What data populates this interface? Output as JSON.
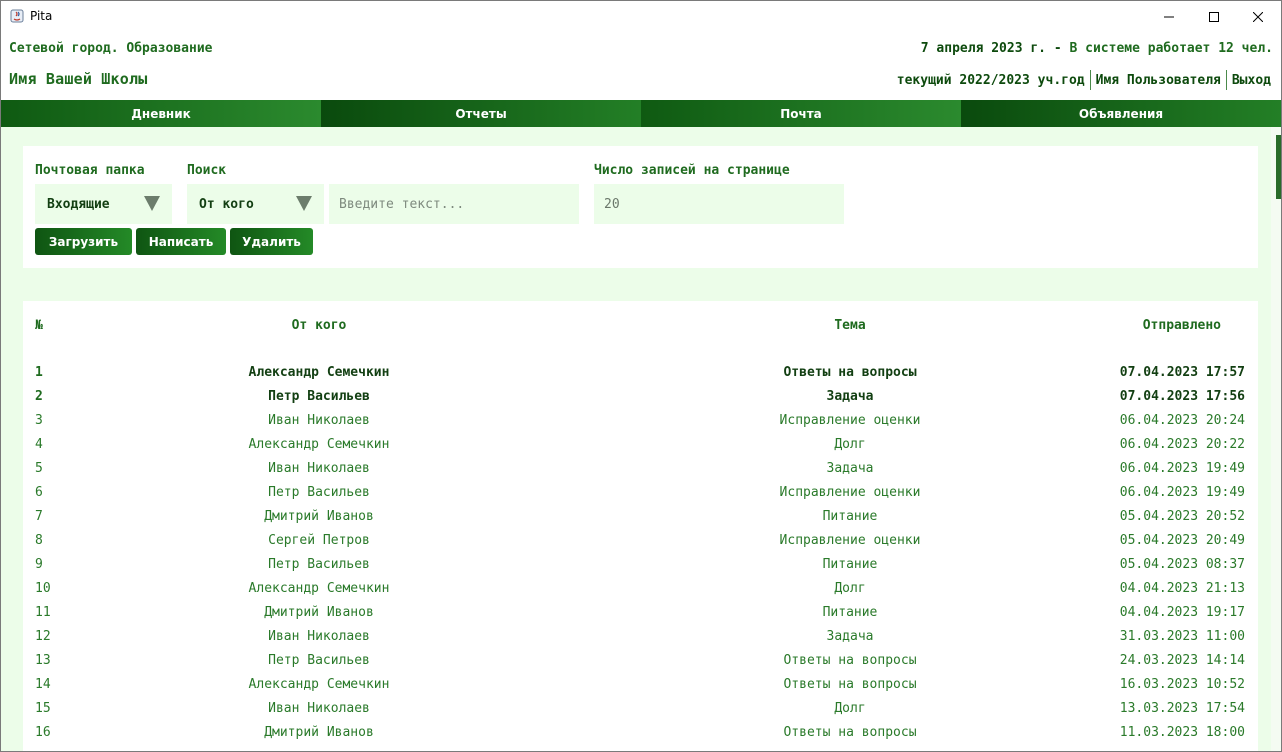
{
  "window": {
    "title": "Pita"
  },
  "header": {
    "org_name": "Сетевой город. Образование",
    "school_name": "Имя Вашей Школы",
    "status_date": "7 апреля 2023 г. -",
    "status_text": "В системе работает 12 чел.",
    "school_year": "текущий 2022/2023 уч.год",
    "user_name": "Имя Пользователя",
    "logout": "Выход"
  },
  "nav": {
    "tabs": [
      {
        "label": "Дневник"
      },
      {
        "label": "Отчеты"
      },
      {
        "label": "Почта"
      },
      {
        "label": "Объявления"
      }
    ]
  },
  "filters": {
    "folder_label": "Почтовая папка",
    "folder_value": "Входящие",
    "search_label": "Поиск",
    "search_field_value": "От кого",
    "search_placeholder": "Введите текст...",
    "per_page_label": "Число записей на странице",
    "per_page_value": "20",
    "buttons": {
      "load": "Загрузить",
      "write": "Написать",
      "delete": "Удалить"
    }
  },
  "table": {
    "columns": {
      "num": "№",
      "from": "От кого",
      "subject": "Тема",
      "sent": "Отправлено"
    },
    "rows": [
      {
        "num": "1",
        "from": "Александр Семечкин",
        "subject": "Ответы на вопросы",
        "sent": "07.04.2023 17:57",
        "unread": true
      },
      {
        "num": "2",
        "from": "Петр Васильев",
        "subject": "Задача",
        "sent": "07.04.2023 17:56",
        "unread": true
      },
      {
        "num": "3",
        "from": "Иван Николаев",
        "subject": "Исправление оценки",
        "sent": "06.04.2023 20:24",
        "unread": false
      },
      {
        "num": "4",
        "from": "Александр Семечкин",
        "subject": "Долг",
        "sent": "06.04.2023 20:22",
        "unread": false
      },
      {
        "num": "5",
        "from": "Иван Николаев",
        "subject": "Задача",
        "sent": "06.04.2023 19:49",
        "unread": false
      },
      {
        "num": "6",
        "from": "Петр Васильев",
        "subject": "Исправление оценки",
        "sent": "06.04.2023 19:49",
        "unread": false
      },
      {
        "num": "7",
        "from": "Дмитрий Иванов",
        "subject": "Питание",
        "sent": "05.04.2023 20:52",
        "unread": false
      },
      {
        "num": "8",
        "from": "Сергей Петров",
        "subject": "Исправление оценки",
        "sent": "05.04.2023 20:49",
        "unread": false
      },
      {
        "num": "9",
        "from": "Петр Васильев",
        "subject": "Питание",
        "sent": "05.04.2023 08:37",
        "unread": false
      },
      {
        "num": "10",
        "from": "Александр Семечкин",
        "subject": "Долг",
        "sent": "04.04.2023 21:13",
        "unread": false
      },
      {
        "num": "11",
        "from": "Дмитрий Иванов",
        "subject": "Питание",
        "sent": "04.04.2023 19:17",
        "unread": false
      },
      {
        "num": "12",
        "from": "Иван Николаев",
        "subject": "Задача",
        "sent": "31.03.2023 11:00",
        "unread": false
      },
      {
        "num": "13",
        "from": "Петр Васильев",
        "subject": "Ответы на вопросы",
        "sent": "24.03.2023 14:14",
        "unread": false
      },
      {
        "num": "14",
        "from": "Александр Семечкин",
        "subject": "Ответы на вопросы",
        "sent": "16.03.2023 10:52",
        "unread": false
      },
      {
        "num": "15",
        "from": "Иван Николаев",
        "subject": "Долг",
        "sent": "13.03.2023 17:54",
        "unread": false
      },
      {
        "num": "16",
        "from": "Дмитрий Иванов",
        "subject": "Ответы на вопросы",
        "sent": "11.03.2023 18:00",
        "unread": false
      }
    ]
  },
  "colors": {
    "accent_dark": "#0a4a0d",
    "accent": "#1f6b1f",
    "panel_bg": "#ecfde9"
  }
}
